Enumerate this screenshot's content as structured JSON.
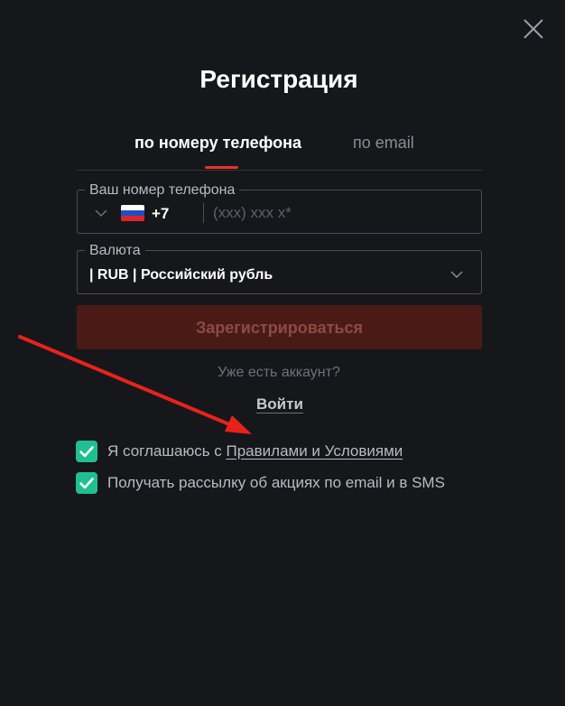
{
  "modal": {
    "title": "Регистрация",
    "close_icon": "close-icon"
  },
  "tabs": [
    {
      "label": "по номеру телефона",
      "active": true
    },
    {
      "label": "по email",
      "active": false
    }
  ],
  "phone_field": {
    "legend": "Ваш номер телефона",
    "country_flag": "russia-flag-icon",
    "country_code": "+7",
    "placeholder": "(xxx) xxx x*",
    "value": ""
  },
  "currency_field": {
    "legend": "Валюта",
    "value": "| RUB | Российский рубль"
  },
  "register_button": {
    "label": "Зарегистрироваться",
    "disabled": true
  },
  "login": {
    "prompt": "Уже есть аккаунт?",
    "link_label": "Войти"
  },
  "agreements": [
    {
      "text": "Я соглашаюсь с ",
      "link": "Правилами и Условиями",
      "checked": true
    },
    {
      "text": "Получать рассылку об акциях по email и в SMS",
      "link": "",
      "checked": true
    }
  ],
  "colors": {
    "background": "#16171b",
    "accent": "#e8332a",
    "checkbox": "#1fbf93",
    "annotation_arrow": "#e8221b"
  }
}
